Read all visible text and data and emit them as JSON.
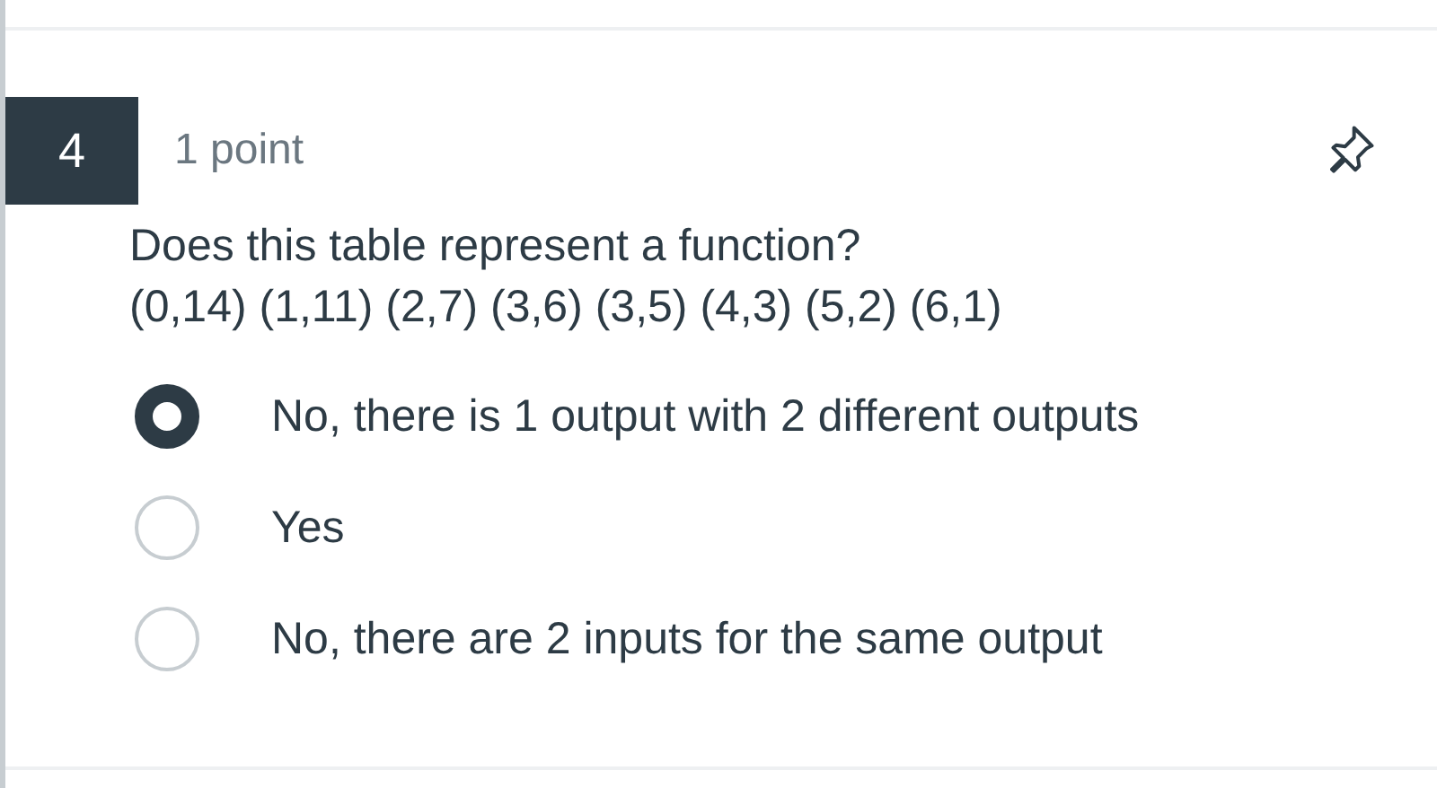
{
  "question": {
    "number": "4",
    "points": "1 point",
    "pinned": false,
    "lines": [
      "Does this table represent a function?",
      "(0,14) (1,11) (2,7) (3,6) (3,5) (4,3) (5,2) (6,1)"
    ]
  },
  "options": [
    {
      "label": "No, there is 1 output with 2 different outputs",
      "selected": true
    },
    {
      "label": "Yes",
      "selected": false
    },
    {
      "label": "No, there are 2 inputs for the same output",
      "selected": false
    }
  ]
}
